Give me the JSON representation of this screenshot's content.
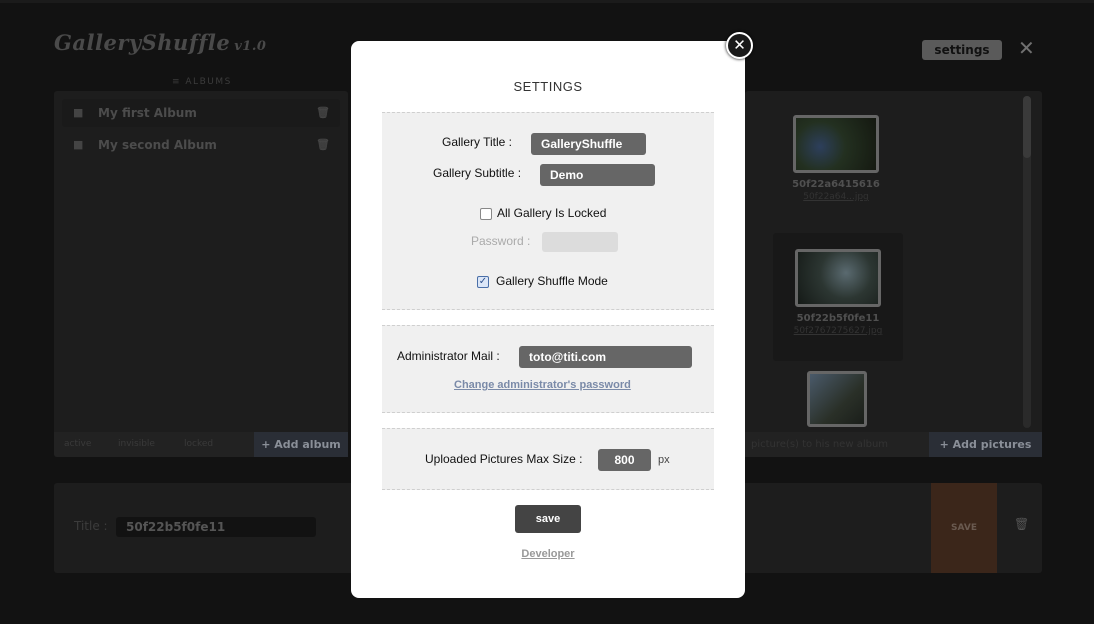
{
  "app": {
    "logo": "GalleryShuffle",
    "version": "v1.0",
    "settings_label": "settings",
    "close_glyph": "✕"
  },
  "albums": {
    "section_label": "≡ ALBUMS",
    "items": [
      {
        "label": "My first Album",
        "icon": "folder-icon",
        "trash": "🗑"
      },
      {
        "label": "My second Album",
        "icon": "locked-folder-icon",
        "trash": "🗑"
      }
    ],
    "legend": [
      "active",
      "invisible",
      "locked"
    ],
    "add_label": "+ Add album"
  },
  "pictures": {
    "items": [
      {
        "name": "50f22a6415616",
        "file": "50f22a64...jpg"
      },
      {
        "name": "50f22b5f0fe11",
        "file": "50f2767275627.jpg"
      },
      {
        "name": "",
        "file": ""
      }
    ],
    "hint": "picture(s) to his new album",
    "add_label": "+ Add pictures"
  },
  "editor": {
    "title_label": "Title :",
    "title_value": "50f22b5f0fe11",
    "save_label": "SAVE"
  },
  "modal": {
    "close_glyph": "✕",
    "title": "SETTINGS",
    "gallery_title_label": "Gallery Title :",
    "gallery_title_value": "GalleryShuffle",
    "gallery_subtitle_label": "Gallery Subtitle :",
    "gallery_subtitle_value": "Demo",
    "all_locked_label": "All Gallery Is Locked",
    "all_locked_checked": false,
    "password_label": "Password :",
    "password_value": "",
    "shuffle_mode_label": "Gallery Shuffle Mode",
    "shuffle_mode_checked": true,
    "admin_mail_label": "Administrator Mail :",
    "admin_mail_value": "toto@titi.com",
    "change_password_link": "Change administrator's password",
    "max_size_label": "Uploaded Pictures Max Size :",
    "max_size_value": "800",
    "max_size_unit": "px",
    "save_label": "save",
    "developer_link": "Developer"
  },
  "colors": {
    "background": "#121212",
    "modal_bg": "#ffffff",
    "field_bg": "#666666",
    "accent_link": "#7a8aa8"
  }
}
